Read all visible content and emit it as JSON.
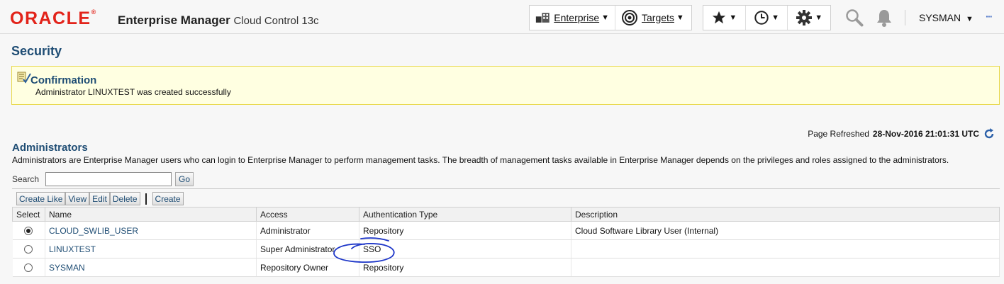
{
  "header": {
    "logo": "ORACLE",
    "product_bold": "Enterprise Manager",
    "product_sub": "Cloud Control 13c",
    "menu_enterprise": "Enterprise",
    "menu_targets": "Targets",
    "user": "SYSMAN"
  },
  "page": {
    "title": "Security"
  },
  "confirmation": {
    "title": "Confirmation",
    "message": "Administrator LINUXTEST was created successfully"
  },
  "refresh": {
    "label": "Page Refreshed",
    "timestamp": "28-Nov-2016 21:01:31 UTC"
  },
  "admins": {
    "title": "Administrators",
    "description": "Administrators are Enterprise Manager users who can login to Enterprise Manager to perform management tasks. The breadth of management tasks available in Enterprise Manager depends on the privileges and roles assigned to the administrators.",
    "search_label": "Search",
    "search_value": "",
    "go_label": "Go",
    "toolbar": {
      "create_like": "Create Like",
      "view": "View",
      "edit": "Edit",
      "delete": "Delete",
      "create": "Create"
    },
    "columns": {
      "select": "Select",
      "name": "Name",
      "access": "Access",
      "auth": "Authentication Type",
      "description": "Description"
    },
    "rows": [
      {
        "name": "CLOUD_SWLIB_USER",
        "access": "Administrator",
        "auth": "Repository",
        "description": "Cloud Software Library User (Internal)",
        "selected": true
      },
      {
        "name": "LINUXTEST",
        "access": "Super Administrator",
        "auth": "SSO",
        "description": "",
        "selected": false
      },
      {
        "name": "SYSMAN",
        "access": "Repository Owner",
        "auth": "Repository",
        "description": "",
        "selected": false
      }
    ]
  },
  "colors": {
    "oracle_red": "#e2231a",
    "title_blue": "#1f4d74",
    "confirm_bg": "#ffffe1",
    "annotation_ink": "#1c35c8"
  },
  "icons": [
    "enterprise-icon",
    "targets-icon",
    "favorites-star-icon",
    "history-clock-icon",
    "settings-gear-icon",
    "search-icon",
    "notification-bell-icon",
    "more-dots-icon",
    "confirmation-icon",
    "refresh-icon",
    "radio-icon"
  ]
}
